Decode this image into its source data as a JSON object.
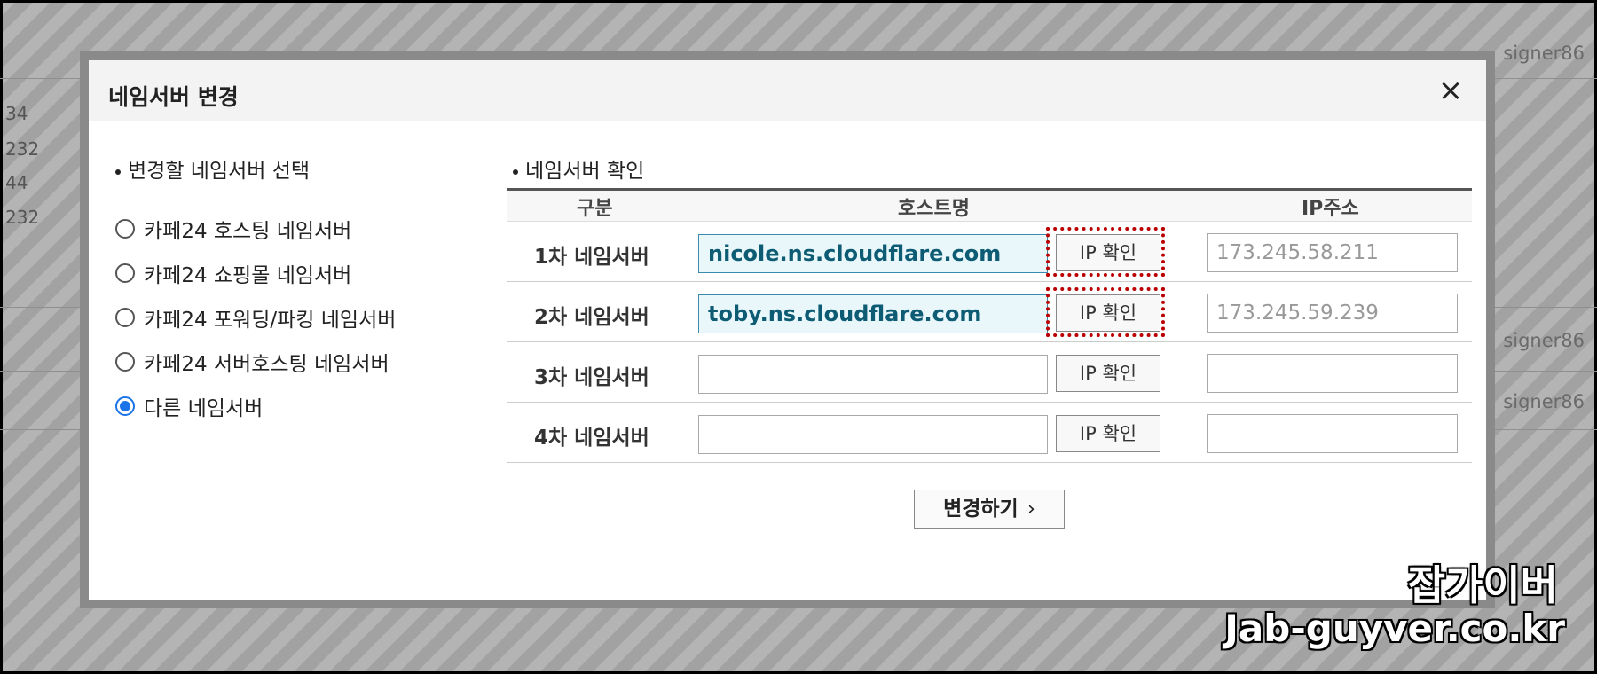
{
  "background": {
    "numbers": [
      "34",
      "232",
      "44",
      "232"
    ],
    "users": [
      "signer86",
      "signer86",
      "signer86"
    ]
  },
  "modal": {
    "title": "네임서버 변경",
    "close_icon": "×",
    "left_title": "변경할 네임서버 선택",
    "right_title": "네임서버 확인",
    "options": [
      {
        "label": "카페24 호스팅 네임서버",
        "checked": false
      },
      {
        "label": "카페24 쇼핑몰 네임서버",
        "checked": false
      },
      {
        "label": "카페24 포워딩/파킹 네임서버",
        "checked": false
      },
      {
        "label": "카페24 서버호스팅 네임서버",
        "checked": false
      },
      {
        "label": "다른 네임서버",
        "checked": true
      }
    ],
    "table": {
      "headers": [
        "구분",
        "호스트명",
        "IP주소"
      ],
      "rows": [
        {
          "label": "1차 네임서버",
          "host": "nicole.ns.cloudflare.com",
          "button": "IP 확인",
          "ip": "173.245.58.211"
        },
        {
          "label": "2차 네임서버",
          "host": "toby.ns.cloudflare.com",
          "button": "IP 확인",
          "ip": "173.245.59.239"
        },
        {
          "label": "3차 네임서버",
          "host": "",
          "button": "IP 확인",
          "ip": ""
        },
        {
          "label": "4차 네임서버",
          "host": "",
          "button": "IP 확인",
          "ip": ""
        }
      ]
    },
    "submit_label": "변경하기",
    "submit_chevron": "›"
  },
  "watermark": {
    "korean": "잡가이버",
    "url": "Jab-guyver.co.kr"
  },
  "colors": {
    "highlight": "#bb0000",
    "radio_selected": "#1a73e8",
    "host_text": "#0d5c74"
  }
}
